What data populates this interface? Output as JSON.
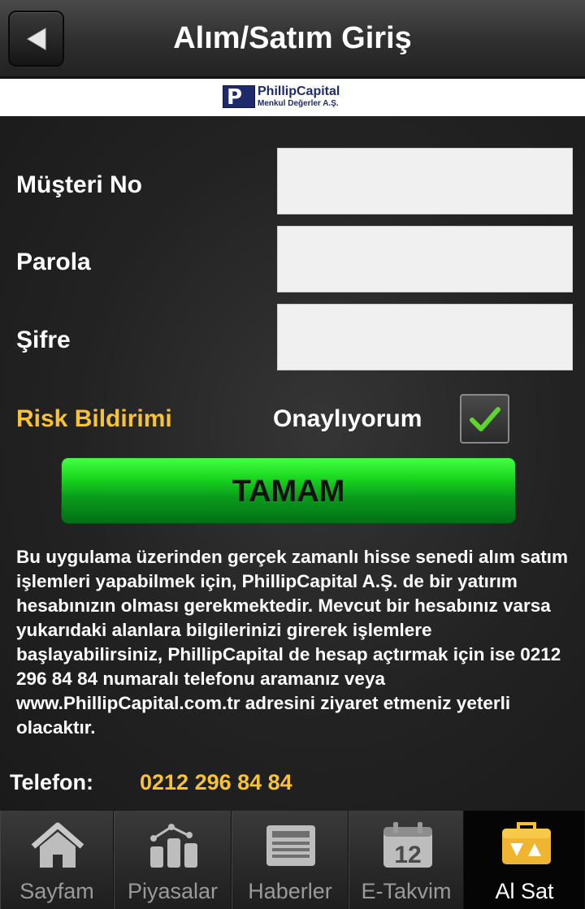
{
  "header": {
    "title": "Alım/Satım Giriş",
    "back_icon": "back-arrow-icon"
  },
  "logo": {
    "name": "PhillipCapital",
    "subtitle": "Menkul Değerler A.Ş.",
    "color": "#1d2b6b"
  },
  "form": {
    "customer_no_label": "Müşteri No",
    "customer_no_value": "",
    "password_label": "Parola",
    "password_value": "",
    "pin_label": "Şifre",
    "pin_value": "",
    "risk_link": "Risk Bildirimi",
    "approve_label": "Onaylıyorum",
    "approve_checked": true,
    "submit_label": "TAMAM"
  },
  "info_text": "Bu uygulama üzerinden gerçek zamanlı hisse senedi alım satım işlemleri yapabilmek için, PhillipCapital A.Ş. de bir yatırım hesabınızın olması gerekmektedir. Mevcut bir hesabınız varsa yukarıdaki alanlara bilgilerinizi girerek işlemlere başlayabilirsiniz, PhillipCapital  de hesap açtırmak için ise 0212 296 84 84 numaralı telefonu aramanız veya www.PhillipCapital.com.tr adresini ziyaret etmeniz yeterli olacaktır.",
  "contact": {
    "phone_label": "Telefon:",
    "phone_value": "0212 296 84 84"
  },
  "tabs": [
    {
      "label": "Sayfam",
      "icon": "home-icon",
      "active": false
    },
    {
      "label": "Piyasalar",
      "icon": "market-chart-icon",
      "active": false
    },
    {
      "label": "Haberler",
      "icon": "newspaper-icon",
      "active": false
    },
    {
      "label": "E-Takvim",
      "icon": "calendar-icon",
      "active": false
    },
    {
      "label": "Al Sat",
      "icon": "trade-briefcase-icon",
      "active": true
    }
  ],
  "colors": {
    "accent_yellow": "#f7c234",
    "button_green": "#1ad81f",
    "check_green": "#5cd62e"
  }
}
